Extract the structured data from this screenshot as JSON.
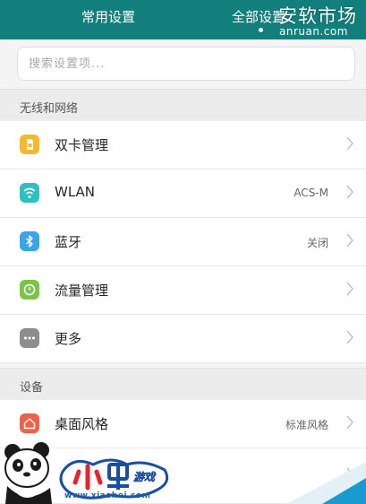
{
  "tabs": [
    {
      "label": "常用设置",
      "active": false
    },
    {
      "label": "全部设置",
      "active": true
    }
  ],
  "search": {
    "placeholder": "搜索设置项..."
  },
  "sections": [
    {
      "title": "无线和网络",
      "items": [
        {
          "label": "双卡管理",
          "value": "",
          "icon": "sim-card-icon",
          "color": "#f5b82e"
        },
        {
          "label": "WLAN",
          "value": "ACS-M",
          "icon": "wifi-icon",
          "color": "#2ebfbf"
        },
        {
          "label": "蓝牙",
          "value": "关闭",
          "icon": "bluetooth-icon",
          "color": "#3ba3e8"
        },
        {
          "label": "流量管理",
          "value": "",
          "icon": "data-usage-icon",
          "color": "#7cc34a"
        },
        {
          "label": "更多",
          "value": "",
          "icon": "more-icon",
          "color": "#8d8d8d"
        }
      ]
    },
    {
      "title": "设备",
      "items": [
        {
          "label": "桌面风格",
          "value": "标准风格",
          "icon": "home-icon",
          "color": "#f0604a"
        }
      ]
    }
  ],
  "watermarks": {
    "anruan_title": "安软市场",
    "anruan_url": "anruan.com",
    "xiaohei_logo": "小黑游戏",
    "xiaohei_game": "游戏",
    "xiaohei_url": "www.xiaohei.com"
  }
}
